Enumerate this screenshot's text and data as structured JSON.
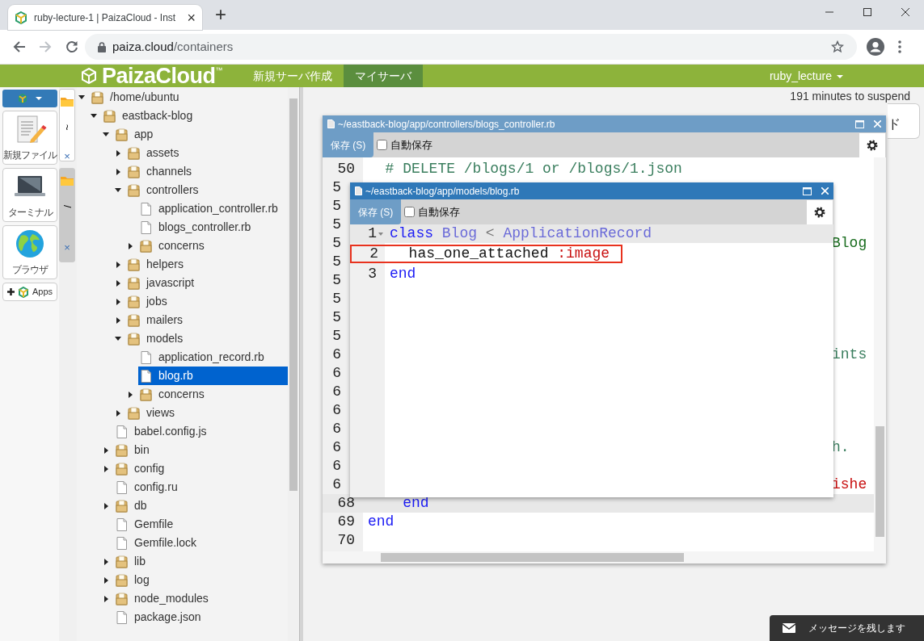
{
  "browser": {
    "tab": {
      "title": "ruby-lecture-1 | PaizaCloud - Inst",
      "close": "×",
      "selected": true
    },
    "new_tab": "+",
    "url": {
      "host": "paiza.cloud",
      "path": "/containers"
    }
  },
  "navbar": {
    "brand": "PaizaCloud",
    "trademark": "™",
    "links": [
      {
        "label": "新規サーバ作成",
        "selected": false
      },
      {
        "label": "マイサーバ",
        "selected": true
      }
    ],
    "user": "ruby_lecture"
  },
  "launcher": [
    {
      "kind": "document",
      "label": "新規ファイル"
    },
    {
      "kind": "terminal",
      "label": "ターミナル"
    },
    {
      "kind": "browser",
      "label": "ブラウザ"
    },
    {
      "kind": "apps",
      "label": "Apps"
    }
  ],
  "side_tabs": [
    {
      "label": "~",
      "close": "×",
      "selected": true
    },
    {
      "label": "/",
      "close": "×",
      "selected": false
    }
  ],
  "file_tree": [
    {
      "name": "/home/ubuntu",
      "kind": "folder",
      "expanded": true,
      "selected": false,
      "children": [
        {
          "name": "eastback-blog",
          "kind": "folder",
          "expanded": true,
          "selected": false,
          "children": [
            {
              "name": "app",
              "kind": "folder",
              "expanded": true,
              "selected": false,
              "children": [
                {
                  "name": "assets",
                  "kind": "folder",
                  "expanded": false,
                  "selected": false
                },
                {
                  "name": "channels",
                  "kind": "folder",
                  "expanded": false,
                  "selected": false
                },
                {
                  "name": "controllers",
                  "kind": "folder",
                  "expanded": true,
                  "selected": false,
                  "children": [
                    {
                      "name": "application_controller.rb",
                      "kind": "file",
                      "selected": false
                    },
                    {
                      "name": "blogs_controller.rb",
                      "kind": "file",
                      "selected": false
                    },
                    {
                      "name": "concerns",
                      "kind": "folder",
                      "expanded": false,
                      "selected": false
                    }
                  ]
                },
                {
                  "name": "helpers",
                  "kind": "folder",
                  "expanded": false,
                  "selected": false
                },
                {
                  "name": "javascript",
                  "kind": "folder",
                  "expanded": false,
                  "selected": false
                },
                {
                  "name": "jobs",
                  "kind": "folder",
                  "expanded": false,
                  "selected": false
                },
                {
                  "name": "mailers",
                  "kind": "folder",
                  "expanded": false,
                  "selected": false
                },
                {
                  "name": "models",
                  "kind": "folder",
                  "expanded": true,
                  "selected": false,
                  "children": [
                    {
                      "name": "application_record.rb",
                      "kind": "file",
                      "selected": false
                    },
                    {
                      "name": "blog.rb",
                      "kind": "file",
                      "selected": true
                    },
                    {
                      "name": "concerns",
                      "kind": "folder",
                      "expanded": false,
                      "selected": false
                    }
                  ]
                },
                {
                  "name": "views",
                  "kind": "folder",
                  "expanded": false,
                  "selected": false
                }
              ]
            },
            {
              "name": "babel.config.js",
              "kind": "file",
              "selected": false
            },
            {
              "name": "bin",
              "kind": "folder",
              "expanded": false,
              "selected": false
            },
            {
              "name": "config",
              "kind": "folder",
              "expanded": false,
              "selected": false
            },
            {
              "name": "config.ru",
              "kind": "file",
              "selected": false
            },
            {
              "name": "db",
              "kind": "folder",
              "expanded": false,
              "selected": false
            },
            {
              "name": "Gemfile",
              "kind": "file",
              "selected": false
            },
            {
              "name": "Gemfile.lock",
              "kind": "file",
              "selected": false
            },
            {
              "name": "lib",
              "kind": "folder",
              "expanded": false,
              "selected": false
            },
            {
              "name": "log",
              "kind": "folder",
              "expanded": false,
              "selected": false
            },
            {
              "name": "node_modules",
              "kind": "folder",
              "expanded": false,
              "selected": false
            },
            {
              "name": "package.json",
              "kind": "file",
              "selected": false
            }
          ]
        }
      ]
    }
  ],
  "workspace": {
    "suspend_notice": "191 minutes to suspend",
    "covered_button": "ド",
    "editors": [
      {
        "title": "~/eastback-blog/app/controllers/blogs_controller.rb",
        "active": false,
        "save_label": "保存 (S)",
        "autosave": {
          "label": "自動保存",
          "checked": false
        },
        "lines": [
          {
            "number": "50",
            "kind": "code",
            "current": false,
            "tokens": [
              {
                "kind": "comment",
                "text": "  # DELETE /blogs/1 or /blogs/1.json"
              }
            ]
          },
          {
            "number": "5",
            "kind": "covered"
          },
          {
            "number": "5",
            "kind": "covered"
          },
          {
            "number": "5",
            "kind": "covered"
          },
          {
            "number": "5",
            "kind": "covered",
            "tokens": [
              {
                "kind": "string",
                "text": "Blog"
              }
            ]
          },
          {
            "number": "5",
            "kind": "covered"
          },
          {
            "number": "5",
            "kind": "covered"
          },
          {
            "number": "5",
            "kind": "covered"
          },
          {
            "number": "5",
            "kind": "covered"
          },
          {
            "number": "5",
            "kind": "covered"
          },
          {
            "number": "6",
            "kind": "covered",
            "tokens": [
              {
                "kind": "comment",
                "text": "ints"
              }
            ]
          },
          {
            "number": "6",
            "kind": "covered"
          },
          {
            "number": "6",
            "kind": "covered"
          },
          {
            "number": "6",
            "kind": "covered"
          },
          {
            "number": "6",
            "kind": "covered"
          },
          {
            "number": "6",
            "kind": "covered",
            "tokens": [
              {
                "kind": "comment",
                "text": "h."
              }
            ]
          },
          {
            "number": "6",
            "kind": "covered"
          },
          {
            "number": "6",
            "kind": "covered",
            "tokens": [
              {
                "kind": "symbol",
                "text": "ishe"
              }
            ]
          },
          {
            "number": "68",
            "kind": "code",
            "current": true,
            "tokens": [
              {
                "kind": "keyword",
                "text": "    end"
              }
            ]
          },
          {
            "number": "69",
            "kind": "code",
            "current": false,
            "tokens": [
              {
                "kind": "keyword",
                "text": "end"
              }
            ]
          },
          {
            "number": "70",
            "kind": "code",
            "current": false
          }
        ]
      },
      {
        "title": "~/eastback-blog/app/models/blog.rb",
        "active": true,
        "save_label": "保存 (S)",
        "autosave": {
          "label": "自動保存",
          "checked": false
        },
        "lines": [
          {
            "number": "1",
            "kind": "code",
            "current": true,
            "highlighted": false,
            "foldable": true,
            "tokens": [
              {
                "kind": "keyword",
                "text": "class"
              },
              {
                "kind": "constant",
                "text": " Blog"
              },
              {
                "kind": "operator",
                "text": " < "
              },
              {
                "kind": "constant",
                "text": "ApplicationRecord"
              }
            ]
          },
          {
            "number": "2",
            "kind": "code",
            "current": false,
            "highlighted": true,
            "foldable": false,
            "tokens": [
              {
                "kind": "plain",
                "text": "  has_one_attached "
              },
              {
                "kind": "symbol",
                "text": ":image"
              }
            ]
          },
          {
            "number": "3",
            "kind": "code",
            "current": false,
            "highlighted": false,
            "foldable": false,
            "tokens": [
              {
                "kind": "keyword",
                "text": "end"
              }
            ]
          }
        ]
      }
    ]
  },
  "message_button": "メッセージを残します"
}
